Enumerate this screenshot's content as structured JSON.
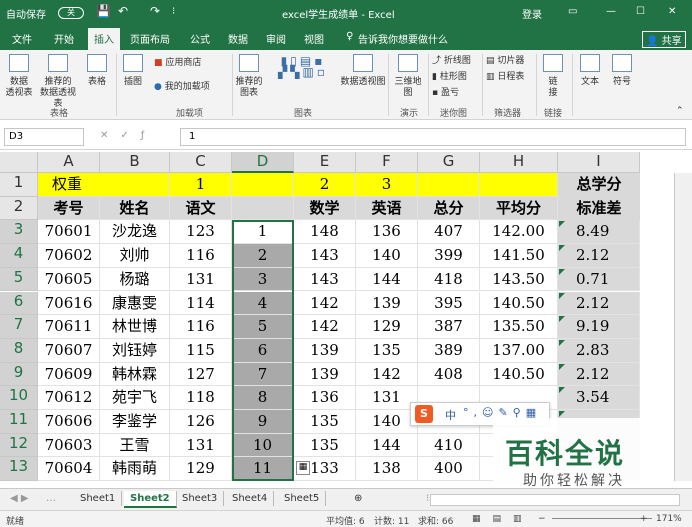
{
  "titlebar": {
    "autosave": "自动保存",
    "toggle": "关",
    "doc_title": "excel学生成绩单 - Excel",
    "login": "登录"
  },
  "menu": [
    "文件",
    "开始",
    "插入",
    "页面布局",
    "公式",
    "数据",
    "审阅",
    "视图"
  ],
  "tell_me": "告诉我你想要做什么",
  "share": "共享",
  "ribbon": {
    "buttons": [
      {
        "label": "数据\n透视表",
        "icon": "pivot-icon"
      },
      {
        "label": "推荐的\n数据透视表",
        "icon": "recommended-pivot-icon"
      },
      {
        "label": "表格",
        "icon": "table-icon"
      },
      {
        "label": "插图",
        "icon": "picture-icon"
      },
      {
        "label": "应用商店",
        "icon": "store-icon"
      },
      {
        "label": "我的加载项",
        "icon": "addin-icon"
      },
      {
        "label": "推荐的\n图表",
        "icon": "recommended-chart-icon"
      },
      {
        "label": "数据透视图",
        "icon": "pivot-chart-icon"
      },
      {
        "label": "三维地\n图",
        "icon": "map3d-icon"
      },
      {
        "label": "折线图",
        "icon": "line-spark-icon"
      },
      {
        "label": "柱形图",
        "icon": "column-spark-icon"
      },
      {
        "label": "盈亏",
        "icon": "winloss-icon"
      },
      {
        "label": "切片器",
        "icon": "slicer-icon"
      },
      {
        "label": "日程表",
        "icon": "timeline-icon"
      },
      {
        "label": "链\n接",
        "icon": "link-icon"
      },
      {
        "label": "文本",
        "icon": "text-icon"
      },
      {
        "label": "符号",
        "icon": "symbol-icon"
      }
    ],
    "groups": [
      "表格",
      "加载项",
      "图表",
      "演示",
      "迷你图",
      "筛选器",
      "链接"
    ]
  },
  "formula": {
    "name_box": "D3",
    "value": "1"
  },
  "columns": [
    "A",
    "B",
    "C",
    "D",
    "E",
    "F",
    "G",
    "H",
    "I"
  ],
  "rows": [
    [
      "权重",
      "",
      "1",
      "",
      "2",
      "3",
      "",
      "",
      ""
    ],
    [
      "考号",
      "姓名",
      "语文",
      "",
      "数学",
      "英语",
      "总分",
      "平均分",
      ""
    ],
    [
      "70601",
      "沙龙逸",
      "123",
      "1",
      "148",
      "136",
      "407",
      "142.00",
      "8.49"
    ],
    [
      "70602",
      "刘帅",
      "116",
      "2",
      "143",
      "140",
      "399",
      "141.50",
      "2.12"
    ],
    [
      "70605",
      "杨璐",
      "131",
      "3",
      "143",
      "144",
      "418",
      "143.50",
      "0.71"
    ],
    [
      "70616",
      "康惠雯",
      "114",
      "4",
      "142",
      "139",
      "395",
      "140.50",
      "2.12"
    ],
    [
      "70611",
      "林世博",
      "116",
      "5",
      "142",
      "129",
      "387",
      "135.50",
      "9.19"
    ],
    [
      "70607",
      "刘钰婷",
      "115",
      "6",
      "139",
      "135",
      "389",
      "137.00",
      "2.83"
    ],
    [
      "70609",
      "韩林霖",
      "127",
      "7",
      "139",
      "142",
      "408",
      "140.50",
      "2.12"
    ],
    [
      "70612",
      "苑宇飞",
      "118",
      "8",
      "136",
      "131",
      "",
      "",
      "3.54"
    ],
    [
      "70606",
      "李鉴学",
      "126",
      "9",
      "135",
      "140",
      "401",
      "",
      ""
    ],
    [
      "70603",
      "王雪",
      "131",
      "10",
      "135",
      "144",
      "410",
      "",
      ""
    ],
    [
      "70604",
      "韩雨萌",
      "129",
      "11",
      "133",
      "138",
      "400",
      "",
      ""
    ]
  ],
  "col_i_header": [
    "总学分",
    "标准差"
  ],
  "sheets": [
    "Sheet1",
    "Sheet2",
    "Sheet3",
    "Sheet4",
    "Sheet5"
  ],
  "active_sheet": 1,
  "status": {
    "ready": "就绪",
    "average": "平均值: 6",
    "count": "计数: 11",
    "sum": "求和: 66",
    "zoom": "171%"
  },
  "ime": {
    "label": "中",
    "logo": "S"
  },
  "watermark": {
    "main": "百科全说",
    "sub": "助你轻松解决"
  },
  "colors": {
    "excel_green": "#217346",
    "yellow": "#ffff00",
    "selection_gray": "#a9a9a9",
    "header_gray": "#d9d9d9",
    "ime_orange": "#f25a24"
  }
}
